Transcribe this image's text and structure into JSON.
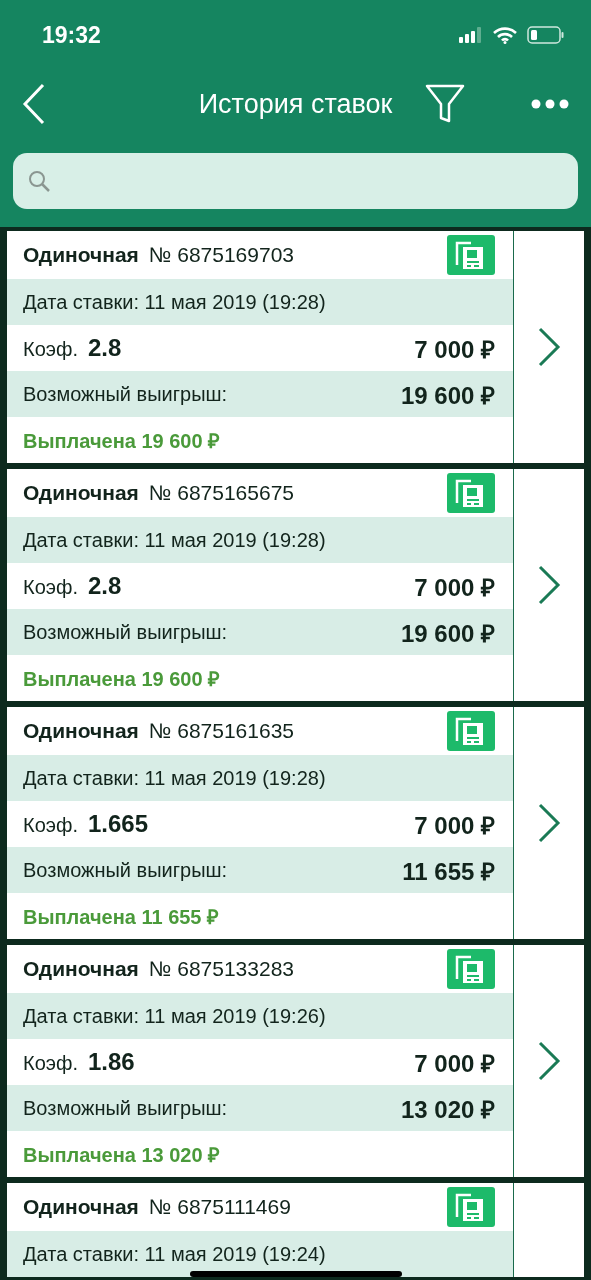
{
  "status_bar": {
    "time": "19:32"
  },
  "nav": {
    "title": "История ставок"
  },
  "bets": [
    {
      "type": "Одиночная",
      "number": "№ 6875169703",
      "date": "Дата ставки: 11 мая 2019 (19:28)",
      "coef_label": "Коэф.",
      "coef": "2.8",
      "stake": "7 000 ₽",
      "win_label": "Возможный выигрыш:",
      "win": "19 600 ₽",
      "status": "Выплачена 19 600 ₽"
    },
    {
      "type": "Одиночная",
      "number": "№ 6875165675",
      "date": "Дата ставки: 11 мая 2019 (19:28)",
      "coef_label": "Коэф.",
      "coef": "2.8",
      "stake": "7 000 ₽",
      "win_label": "Возможный выигрыш:",
      "win": "19 600 ₽",
      "status": "Выплачена 19 600 ₽"
    },
    {
      "type": "Одиночная",
      "number": "№ 6875161635",
      "date": "Дата ставки: 11 мая 2019 (19:28)",
      "coef_label": "Коэф.",
      "coef": "1.665",
      "stake": "7 000 ₽",
      "win_label": "Возможный выигрыш:",
      "win": "11 655 ₽",
      "status": "Выплачена 11 655 ₽"
    },
    {
      "type": "Одиночная",
      "number": "№ 6875133283",
      "date": "Дата ставки: 11 мая 2019 (19:26)",
      "coef_label": "Коэф.",
      "coef": "1.86",
      "stake": "7 000 ₽",
      "win_label": "Возможный выигрыш:",
      "win": "13 020 ₽",
      "status": "Выплачена 13 020 ₽"
    },
    {
      "type": "Одиночная",
      "number": "№ 6875111469",
      "date": "Дата ставки: 11 мая 2019 (19:24)"
    }
  ]
}
